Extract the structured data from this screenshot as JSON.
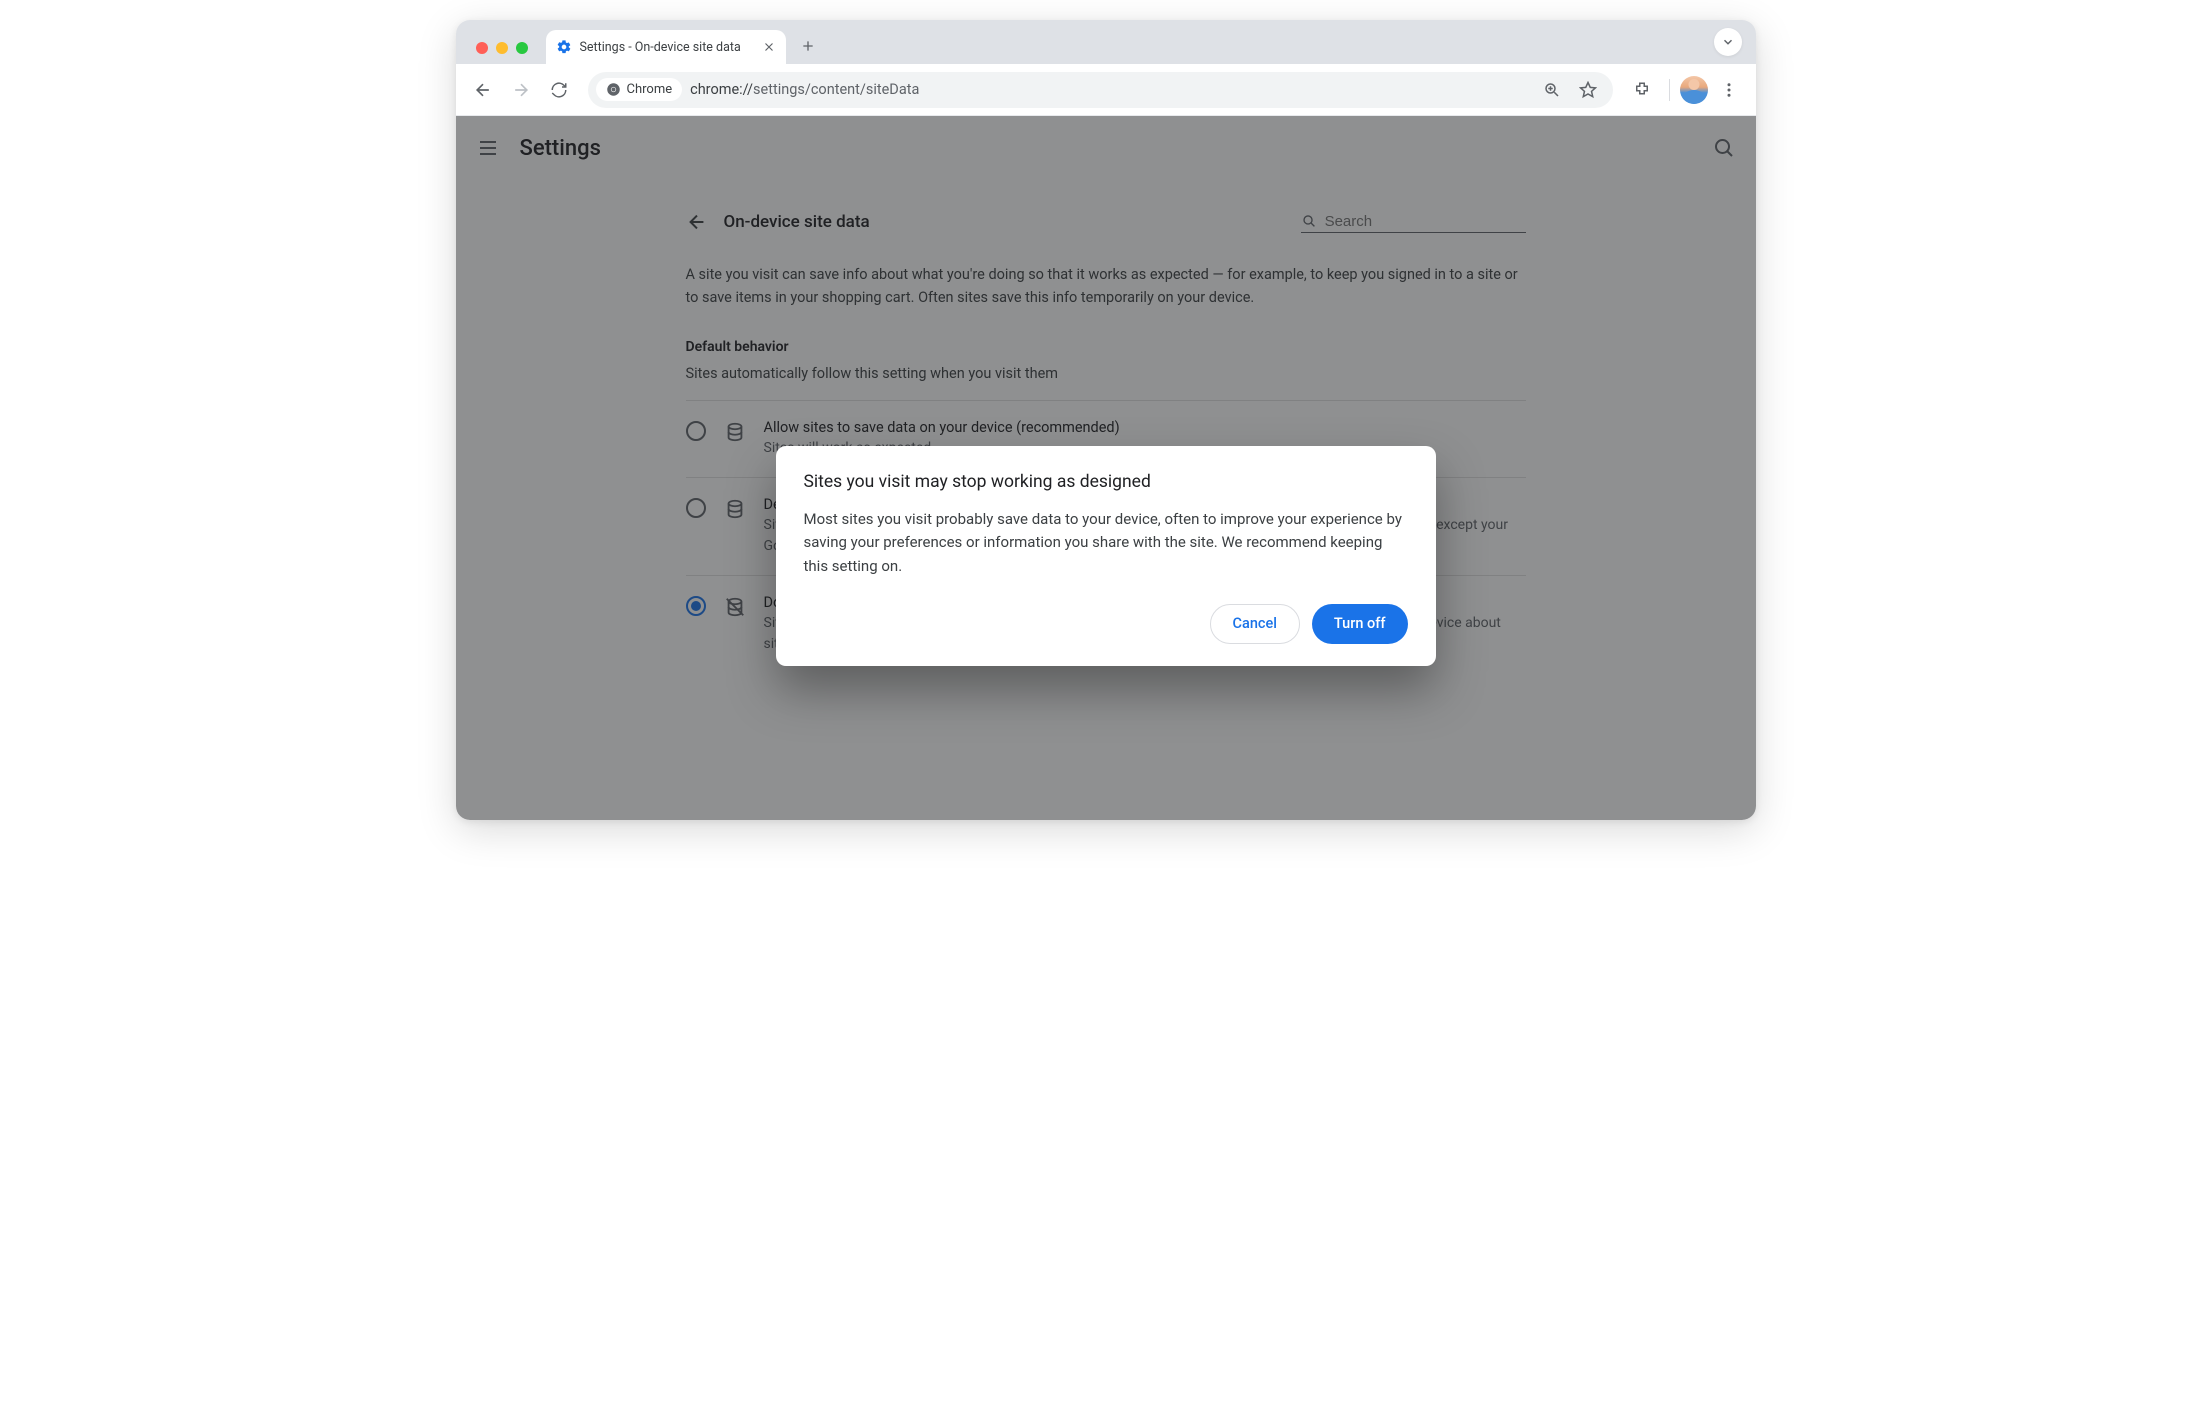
{
  "browser": {
    "tab_title": "Settings - On-device site data",
    "omnibox_chip": "Chrome",
    "url_scheme": "chrome://",
    "url_path": "settings/content/siteData"
  },
  "header": {
    "title": "Settings"
  },
  "page": {
    "back_label": "On-device site data",
    "search_placeholder": "Search",
    "intro": "A site you visit can save info about what you're doing so that it works as expected — for example, to keep you signed in to a site or to save items in your shopping cart. Often sites save this info temporarily on your device.",
    "default_heading": "Default behavior",
    "default_sub": "Sites automatically follow this setting when you visit them",
    "options": [
      {
        "title": "Allow sites to save data on your device (recommended)",
        "desc": "Sites will work as expected.",
        "selected": false
      },
      {
        "title": "Delete data sites have saved to your device when you close all windows",
        "desc": "Sites will probably work as expected. You'll be signed out of most sites when you close all Chrome windows, except your Google Account if you're signed in to Chrome.",
        "selected": false
      },
      {
        "title": "Don't allow sites to save data on your device (not recommended)",
        "desc": "Sites may not work as you would expect. Choose this option if you don't want to leave information on your device about sites you visit.",
        "selected": true
      }
    ]
  },
  "dialog": {
    "title": "Sites you visit may stop working as designed",
    "body": "Most sites you visit probably save data to your device, often to improve your experience by saving your preferences or information you share with the site. We recommend keeping this setting on.",
    "cancel": "Cancel",
    "confirm": "Turn off"
  }
}
